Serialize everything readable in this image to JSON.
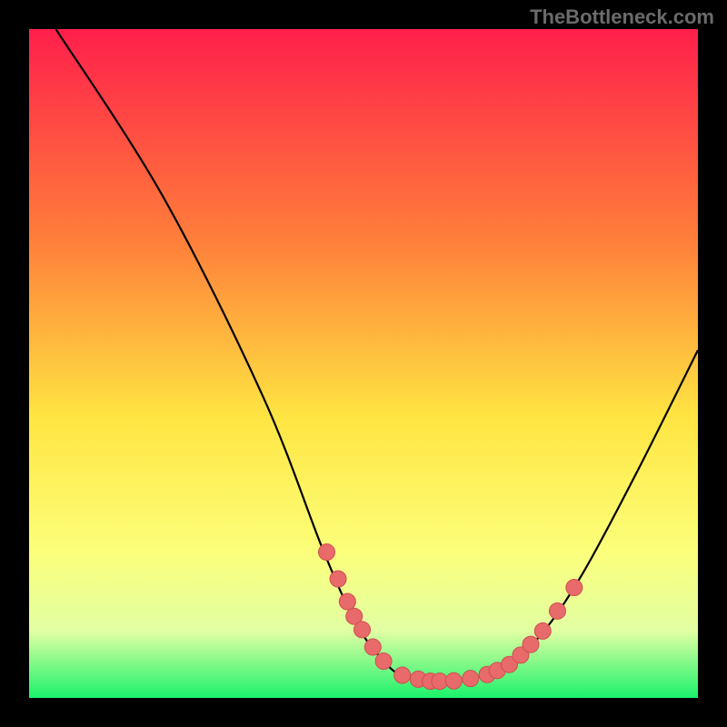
{
  "watermark": "TheBottleneck.com",
  "colors": {
    "frame_bg": "#000000",
    "grad_top": "#ff1f4b",
    "grad_mid_upper": "#ff803a",
    "grad_mid": "#ffe542",
    "grad_lower": "#fcff7a",
    "grad_lowest": "#e1ffa3",
    "grad_bottom": "#1bf26b",
    "curve_stroke": "#000000",
    "marker_fill": "#e86a6a",
    "marker_stroke": "#cf4f4f"
  },
  "chart_data": {
    "type": "line",
    "title": "",
    "xlabel": "",
    "ylabel": "",
    "xlim": [
      0,
      100
    ],
    "ylim": [
      0,
      100
    ],
    "curve": [
      {
        "x": 4,
        "y": 100
      },
      {
        "x": 20,
        "y": 75
      },
      {
        "x": 35,
        "y": 45
      },
      {
        "x": 44,
        "y": 22
      },
      {
        "x": 49,
        "y": 11
      },
      {
        "x": 53,
        "y": 5.5
      },
      {
        "x": 56,
        "y": 3.2
      },
      {
        "x": 60,
        "y": 2.5
      },
      {
        "x": 64,
        "y": 2.6
      },
      {
        "x": 68,
        "y": 3.4
      },
      {
        "x": 72,
        "y": 5.2
      },
      {
        "x": 77,
        "y": 10
      },
      {
        "x": 83,
        "y": 19
      },
      {
        "x": 91,
        "y": 34
      },
      {
        "x": 100,
        "y": 52
      }
    ],
    "markers_left": [
      {
        "x": 44.5,
        "y": 21.8
      },
      {
        "x": 46.2,
        "y": 17.8
      },
      {
        "x": 47.6,
        "y": 14.4
      },
      {
        "x": 48.6,
        "y": 12.2
      },
      {
        "x": 49.8,
        "y": 10.2
      },
      {
        "x": 51.4,
        "y": 7.6
      },
      {
        "x": 53.0,
        "y": 5.5
      }
    ],
    "markers_bottom": [
      {
        "x": 55.8,
        "y": 3.4
      },
      {
        "x": 58.2,
        "y": 2.8
      },
      {
        "x": 60.0,
        "y": 2.5
      },
      {
        "x": 61.4,
        "y": 2.5
      },
      {
        "x": 63.5,
        "y": 2.55
      },
      {
        "x": 66.0,
        "y": 2.9
      },
      {
        "x": 68.5,
        "y": 3.5
      },
      {
        "x": 70.0,
        "y": 4.1
      }
    ],
    "markers_right": [
      {
        "x": 71.8,
        "y": 5.0
      },
      {
        "x": 73.5,
        "y": 6.4
      },
      {
        "x": 75.0,
        "y": 8.0
      },
      {
        "x": 76.8,
        "y": 10.0
      },
      {
        "x": 79.0,
        "y": 13.0
      },
      {
        "x": 81.5,
        "y": 16.5
      }
    ]
  }
}
